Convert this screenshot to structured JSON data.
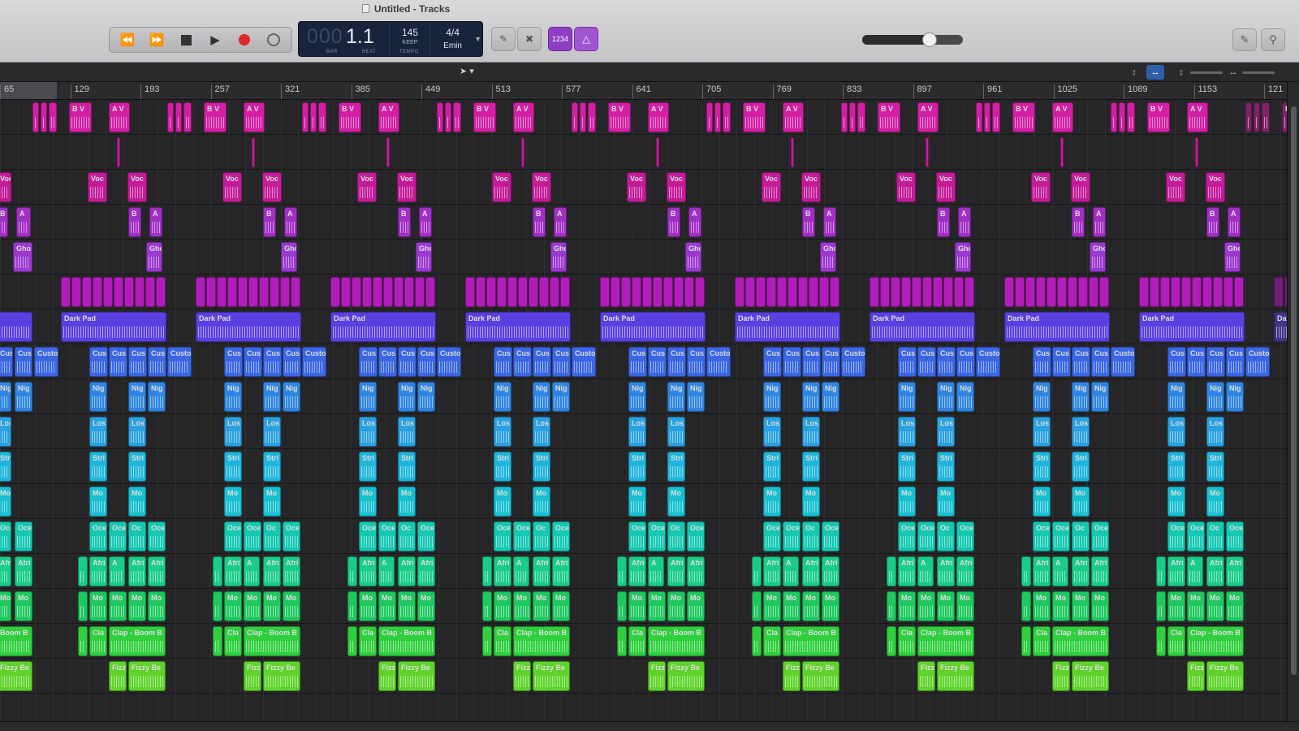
{
  "window": {
    "title": "Untitled - Tracks"
  },
  "transport": {
    "rewind_icon": "rewind-icon",
    "forward_icon": "fast-forward-icon",
    "stop_icon": "stop-icon",
    "play_icon": "play-icon",
    "record_icon": "record-icon",
    "cycle_icon": "cycle-icon"
  },
  "lcd": {
    "position_dim": "000",
    "position": "1.1",
    "bar_label": "BAR",
    "beat_label": "BEAT",
    "tempo": "145",
    "tempo_mode": "KEEP",
    "tempo_label": "TEMPO",
    "signature": "4/4",
    "key": "Emin"
  },
  "tools": {
    "count_in": "1234"
  },
  "volume": {
    "level": 0.7
  },
  "colors": {
    "background": "#1f1f21",
    "accent_blue": "#2f5fa8",
    "record_red": "#e0262b"
  },
  "ruler": {
    "bars": [
      "65",
      "129",
      "193",
      "257",
      "321",
      "385",
      "449",
      "513",
      "577",
      "641",
      "705",
      "769",
      "833",
      "897",
      "961",
      "1025",
      "1089",
      "1153",
      "121"
    ]
  },
  "track_labels": {
    "voc": "Voc",
    "b": "B",
    "a": "A",
    "gho": "Gho",
    "pad": "Dark Pad",
    "cus": "Cus",
    "custo": "Custo",
    "nig": "Nig",
    "los": "Los",
    "stri": "Stri",
    "mo": "Mo",
    "oce": "Oce",
    "oc": "Oc",
    "afri": "Afri",
    "m": "M",
    "c": "C",
    "cla": "Cla",
    "clap": "Clap - Boom B",
    "boom": "Boom B",
    "fizz": "Fizz",
    "fizzy": "Fizzy Be"
  }
}
